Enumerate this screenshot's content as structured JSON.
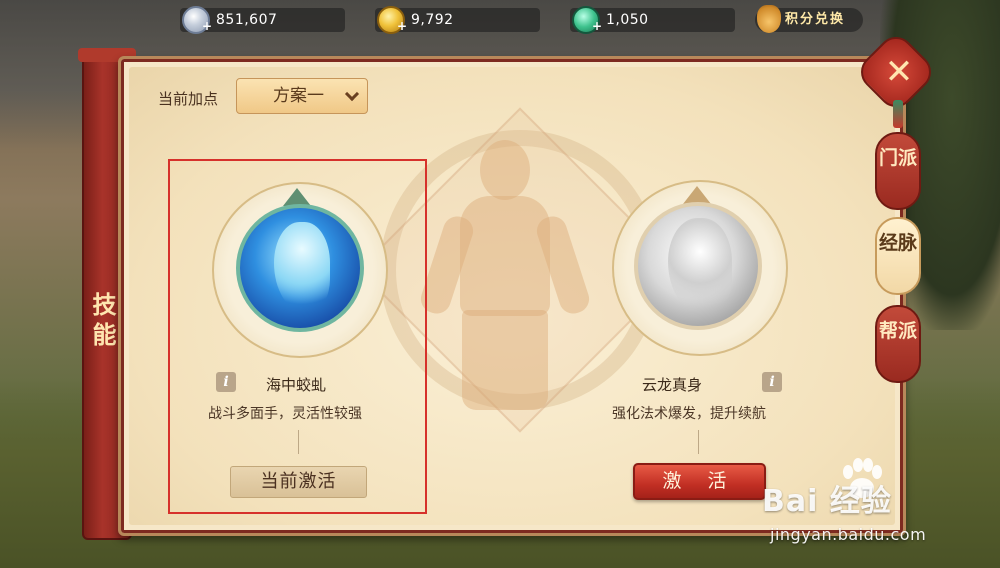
{
  "currencies": [
    {
      "icon": "silver-coin-icon",
      "value": "851,607"
    },
    {
      "icon": "gold-coin-icon",
      "value": "9,792"
    },
    {
      "icon": "jade-icon",
      "value": "1,050"
    }
  ],
  "points_exchange": {
    "icon": "money-bag-icon",
    "label": "积分兑换"
  },
  "side_tab": {
    "label": "技能"
  },
  "scheme": {
    "label": "当前加点",
    "selected": "方案一"
  },
  "skills": [
    {
      "name": "海中蛟虬",
      "description": "战斗多面手，灵活性较强",
      "button": "当前激活",
      "selected": true
    },
    {
      "name": "云龙真身",
      "description": "强化法术爆发，提升续航",
      "button": "激 活",
      "selected": false
    }
  ],
  "right_tabs": [
    {
      "label": "门派",
      "active": false
    },
    {
      "label": "经脉",
      "active": true
    },
    {
      "label": "帮派",
      "active": false
    }
  ],
  "info_icon_text": "i",
  "colors": {
    "accent_red": "#c12f24",
    "selection_border": "#d6312b",
    "panel_bg": "#f6e7c8"
  },
  "watermark": {
    "logo": "Bai  经验",
    "url": "jingyan.baidu.com"
  }
}
